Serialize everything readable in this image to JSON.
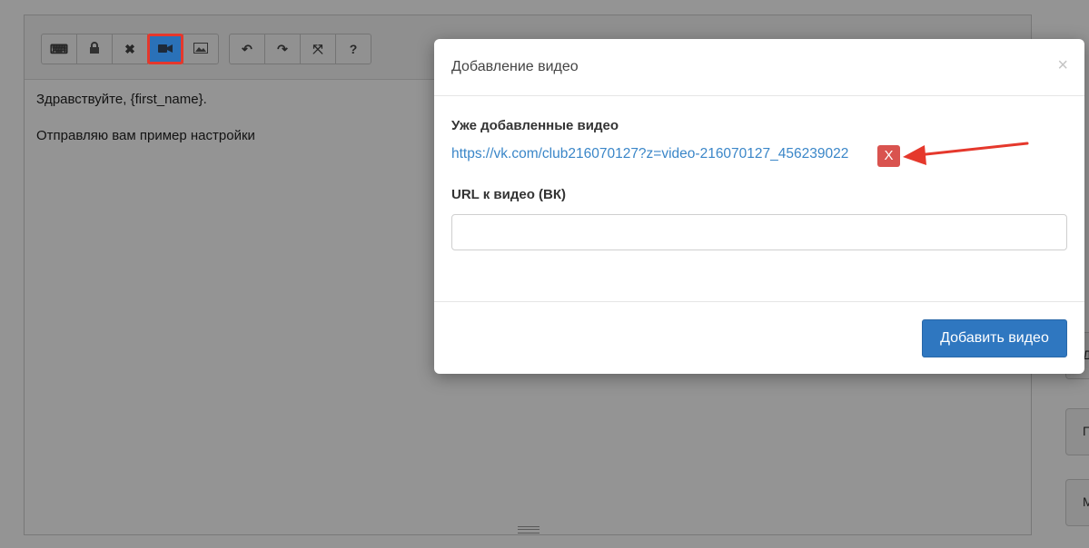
{
  "editor": {
    "toolbar": {
      "group1": [
        {
          "icon": "keyboard-icon",
          "glyph": "⌨"
        },
        {
          "icon": "lock-icon",
          "glyph": "🔒"
        },
        {
          "icon": "clear-format-icon",
          "glyph": "✖"
        },
        {
          "icon": "video-camera-icon",
          "glyph": "■"
        },
        {
          "icon": "image-icon",
          "glyph": "▣"
        }
      ],
      "group2": [
        {
          "icon": "undo-icon",
          "glyph": "↶"
        },
        {
          "icon": "redo-icon",
          "glyph": "↷"
        },
        {
          "icon": "fullscreen-icon",
          "glyph": "⤧"
        },
        {
          "icon": "help-icon",
          "glyph": "?"
        }
      ]
    },
    "lines": [
      "Здравствуйте, {first_name}.",
      "Отправляю вам пример настройки"
    ]
  },
  "side_buttons": [
    "Д",
    "П",
    "М"
  ],
  "modal": {
    "title": "Добавление видео",
    "close_glyph": "×",
    "added_label": "Уже добавленные видео",
    "video_url": "https://vk.com/club216070127?z=video-216070127_456239022",
    "remove_label": "X",
    "url_label": "URL к видео (ВК)",
    "url_value": "",
    "submit_label": "Добавить видео"
  },
  "colors": {
    "primary": "#2f77c0",
    "danger": "#d9534f",
    "link": "#3a86c8",
    "annotation": "#e5382c"
  }
}
